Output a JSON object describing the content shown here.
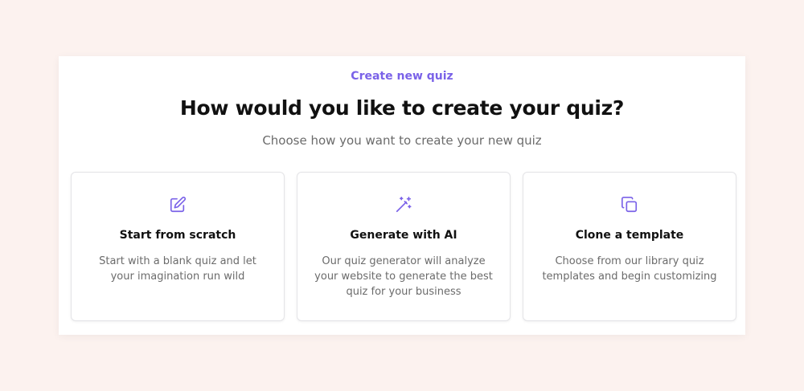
{
  "header": {
    "eyebrow": "Create new quiz",
    "title": "How would you like to create your quiz?",
    "subtitle": "Choose how you want to create your new quiz"
  },
  "options": [
    {
      "icon": "edit-icon",
      "title": "Start from scratch",
      "description": "Start with a blank quiz and let your imagination run wild"
    },
    {
      "icon": "magic-wand-icon",
      "title": "Generate with AI",
      "description": "Our quiz generator will analyze your website to generate the best quiz for your business"
    },
    {
      "icon": "copy-icon",
      "title": "Clone a template",
      "description": "Choose from our library quiz templates and begin customizing"
    }
  ],
  "colors": {
    "background": "#fcf2ef",
    "accent": "#7a62e8",
    "title": "#111111",
    "muted": "#6b6b6b",
    "card_border": "#e4e4e7"
  }
}
